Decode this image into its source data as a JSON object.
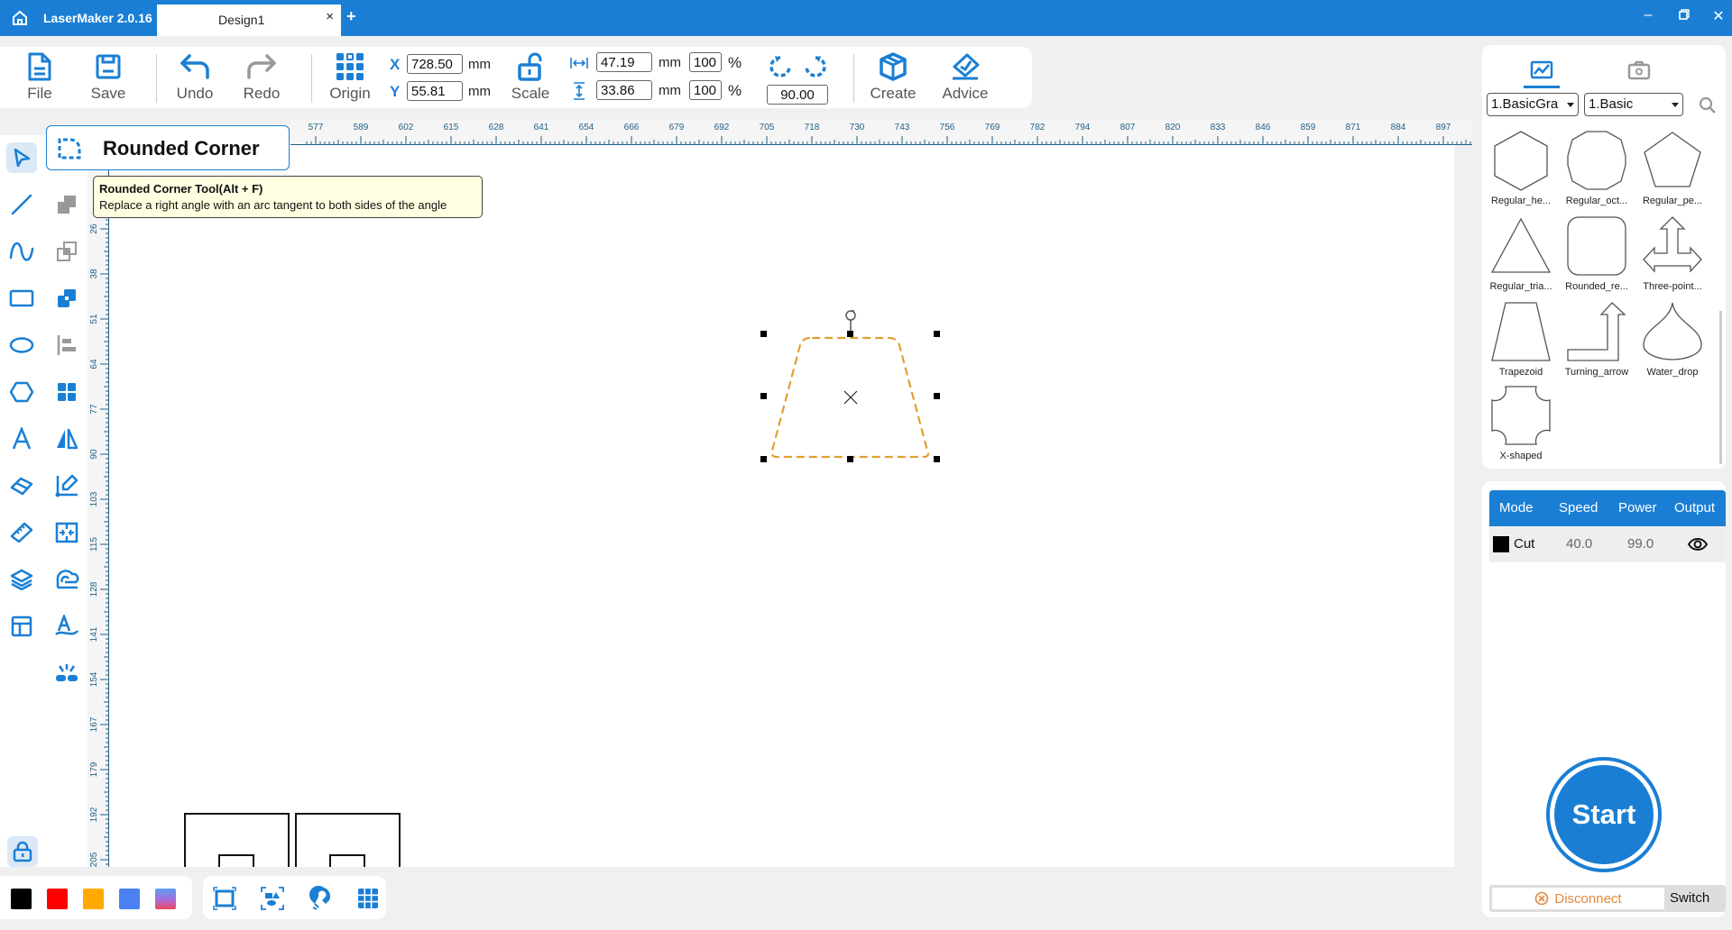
{
  "titlebar": {
    "app_name": "LaserMaker 2.0.16",
    "tab_name": "Design1",
    "close_tab": "×",
    "new_tab": "+"
  },
  "toolbar": {
    "file": "File",
    "save": "Save",
    "undo": "Undo",
    "redo": "Redo",
    "origin": "Origin",
    "scale": "Scale",
    "create": "Create",
    "advice": "Advice",
    "x_label": "X",
    "y_label": "Y",
    "x_value": "728.50",
    "y_value": "55.81",
    "unit": "mm",
    "width_value": "47.19",
    "height_value": "33.86",
    "width_pct": "100",
    "height_pct": "100",
    "pct": "%",
    "rotation_value": "90.00"
  },
  "ruler": {
    "horizontal": [
      "577",
      "589",
      "602",
      "615",
      "628",
      "641",
      "654",
      "666",
      "679",
      "692",
      "705",
      "718",
      "730",
      "743",
      "756",
      "769",
      "782",
      "794",
      "807",
      "820",
      "833",
      "846",
      "859",
      "871",
      "884",
      "897"
    ],
    "vertical": [
      "26",
      "38",
      "51",
      "64",
      "77",
      "90",
      "103",
      "115",
      "128",
      "141",
      "154",
      "167",
      "179",
      "192",
      "205"
    ]
  },
  "popup": {
    "title": "Rounded Corner",
    "tooltip_title": "Rounded Corner Tool(Alt + F)",
    "tooltip_desc": "Replace a right angle with an arc tangent to both sides of the angle"
  },
  "left_tools": [
    {
      "name": "select",
      "icon": "pointer-icon"
    },
    {
      "name": "line",
      "icon": "line-icon"
    },
    {
      "name": "curve",
      "icon": "curve-icon"
    },
    {
      "name": "rectangle",
      "icon": "rectangle-icon"
    },
    {
      "name": "ellipse",
      "icon": "ellipse-icon"
    },
    {
      "name": "polygon",
      "icon": "hexagon-icon"
    },
    {
      "name": "text",
      "icon": "text-icon"
    },
    {
      "name": "eraser",
      "icon": "eraser-icon"
    },
    {
      "name": "measure",
      "icon": "ruler-icon"
    },
    {
      "name": "layers",
      "icon": "layers-icon"
    },
    {
      "name": "layout",
      "icon": "layout-icon"
    }
  ],
  "right_panel": {
    "category_select": "1.BasicGra",
    "sub_select": "1.Basic",
    "shapes": [
      "Regular_he...",
      "Regular_oct...",
      "Regular_pe...",
      "Regular_tria...",
      "Rounded_re...",
      "Three-point...",
      "Trapezoid",
      "Turning_arrow",
      "Water_drop",
      "X-shaped"
    ]
  },
  "layers": {
    "headers": [
      "Mode",
      "Speed",
      "Power",
      "Output"
    ],
    "rows": [
      {
        "color": "#000000",
        "mode": "Cut",
        "speed": "40.0",
        "power": "99.0",
        "output": "eye-icon"
      }
    ]
  },
  "machine": {
    "start": "Start",
    "disconnect": "Disconnect",
    "switch": "Switch"
  },
  "colors": {
    "accent": "#1a7fd4",
    "selection": "#e0a030",
    "swatches": [
      "#000000",
      "#ff0000",
      "#ffaa00",
      "#4a80f0",
      "gradient"
    ]
  }
}
